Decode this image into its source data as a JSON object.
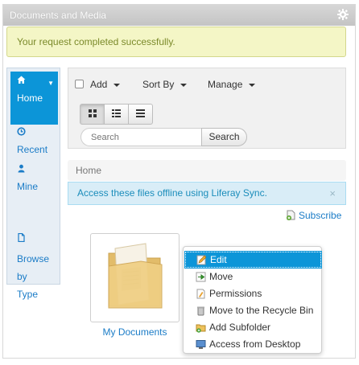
{
  "portlet": {
    "title": "Documents and Media",
    "icon": "gear-icon"
  },
  "alert_success": "Your request completed successfully.",
  "nav": {
    "items": [
      {
        "label": "Home",
        "icon": "home-icon",
        "active": true
      },
      {
        "label": "Recent",
        "icon": "clock-icon"
      },
      {
        "label": "Mine",
        "icon": "user-icon"
      },
      {
        "label": "Browse\nby\nType",
        "icon": "file-icon"
      }
    ]
  },
  "toolbar": {
    "add_label": "Add",
    "sort_label": "Sort By",
    "manage_label": "Manage",
    "views": [
      "icon-view-icon",
      "descriptive-view-icon",
      "list-view-icon"
    ],
    "search_placeholder": "Search",
    "search_button": "Search"
  },
  "breadcrumb": "Home",
  "alert_info": {
    "text": "Access these files offline using Liferay Sync.",
    "close": "×"
  },
  "subscribe": "Subscribe",
  "folder": {
    "label": "My Documents"
  },
  "context_menu": {
    "items": [
      {
        "label": "Edit",
        "icon": "edit-icon",
        "highlighted": true
      },
      {
        "label": "Move",
        "icon": "move-icon"
      },
      {
        "label": "Permissions",
        "icon": "permissions-icon"
      },
      {
        "label": "Move to the Recycle Bin",
        "icon": "trash-icon"
      },
      {
        "label": "Add Subfolder",
        "icon": "add-folder-icon"
      },
      {
        "label": "Access from Desktop",
        "icon": "desktop-icon"
      }
    ]
  },
  "colors": {
    "accent": "#0c95d8",
    "link": "#1b7cc7",
    "success_bg": "#f4f6c6",
    "info_bg": "#d9edf7"
  }
}
